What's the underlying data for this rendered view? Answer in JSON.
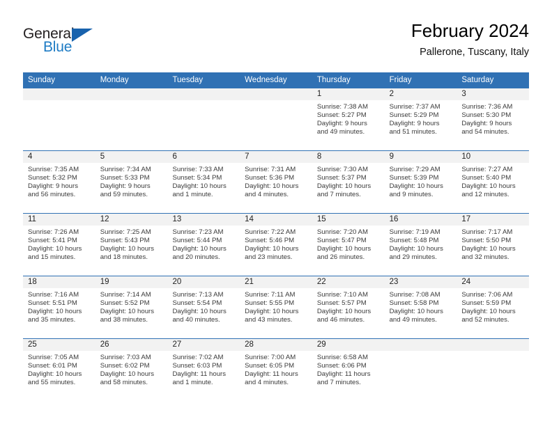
{
  "brand": {
    "name_part1": "General",
    "name_part2": "Blue"
  },
  "header": {
    "title": "February 2024",
    "location": "Pallerone, Tuscany, Italy"
  },
  "weekdays": [
    "Sunday",
    "Monday",
    "Tuesday",
    "Wednesday",
    "Thursday",
    "Friday",
    "Saturday"
  ],
  "colors": {
    "header_blue": "#3071b4",
    "day_band_grey": "#f2f2f2",
    "logo_blue": "#1d7bc4",
    "logo_dark": "#231f20"
  },
  "weeks": [
    [
      {
        "day": "",
        "sunrise": "",
        "sunset": "",
        "daylight_line1": "",
        "daylight_line2": ""
      },
      {
        "day": "",
        "sunrise": "",
        "sunset": "",
        "daylight_line1": "",
        "daylight_line2": ""
      },
      {
        "day": "",
        "sunrise": "",
        "sunset": "",
        "daylight_line1": "",
        "daylight_line2": ""
      },
      {
        "day": "",
        "sunrise": "",
        "sunset": "",
        "daylight_line1": "",
        "daylight_line2": ""
      },
      {
        "day": "1",
        "sunrise": "Sunrise: 7:38 AM",
        "sunset": "Sunset: 5:27 PM",
        "daylight_line1": "Daylight: 9 hours",
        "daylight_line2": "and 49 minutes."
      },
      {
        "day": "2",
        "sunrise": "Sunrise: 7:37 AM",
        "sunset": "Sunset: 5:29 PM",
        "daylight_line1": "Daylight: 9 hours",
        "daylight_line2": "and 51 minutes."
      },
      {
        "day": "3",
        "sunrise": "Sunrise: 7:36 AM",
        "sunset": "Sunset: 5:30 PM",
        "daylight_line1": "Daylight: 9 hours",
        "daylight_line2": "and 54 minutes."
      }
    ],
    [
      {
        "day": "4",
        "sunrise": "Sunrise: 7:35 AM",
        "sunset": "Sunset: 5:32 PM",
        "daylight_line1": "Daylight: 9 hours",
        "daylight_line2": "and 56 minutes."
      },
      {
        "day": "5",
        "sunrise": "Sunrise: 7:34 AM",
        "sunset": "Sunset: 5:33 PM",
        "daylight_line1": "Daylight: 9 hours",
        "daylight_line2": "and 59 minutes."
      },
      {
        "day": "6",
        "sunrise": "Sunrise: 7:33 AM",
        "sunset": "Sunset: 5:34 PM",
        "daylight_line1": "Daylight: 10 hours",
        "daylight_line2": "and 1 minute."
      },
      {
        "day": "7",
        "sunrise": "Sunrise: 7:31 AM",
        "sunset": "Sunset: 5:36 PM",
        "daylight_line1": "Daylight: 10 hours",
        "daylight_line2": "and 4 minutes."
      },
      {
        "day": "8",
        "sunrise": "Sunrise: 7:30 AM",
        "sunset": "Sunset: 5:37 PM",
        "daylight_line1": "Daylight: 10 hours",
        "daylight_line2": "and 7 minutes."
      },
      {
        "day": "9",
        "sunrise": "Sunrise: 7:29 AM",
        "sunset": "Sunset: 5:39 PM",
        "daylight_line1": "Daylight: 10 hours",
        "daylight_line2": "and 9 minutes."
      },
      {
        "day": "10",
        "sunrise": "Sunrise: 7:27 AM",
        "sunset": "Sunset: 5:40 PM",
        "daylight_line1": "Daylight: 10 hours",
        "daylight_line2": "and 12 minutes."
      }
    ],
    [
      {
        "day": "11",
        "sunrise": "Sunrise: 7:26 AM",
        "sunset": "Sunset: 5:41 PM",
        "daylight_line1": "Daylight: 10 hours",
        "daylight_line2": "and 15 minutes."
      },
      {
        "day": "12",
        "sunrise": "Sunrise: 7:25 AM",
        "sunset": "Sunset: 5:43 PM",
        "daylight_line1": "Daylight: 10 hours",
        "daylight_line2": "and 18 minutes."
      },
      {
        "day": "13",
        "sunrise": "Sunrise: 7:23 AM",
        "sunset": "Sunset: 5:44 PM",
        "daylight_line1": "Daylight: 10 hours",
        "daylight_line2": "and 20 minutes."
      },
      {
        "day": "14",
        "sunrise": "Sunrise: 7:22 AM",
        "sunset": "Sunset: 5:46 PM",
        "daylight_line1": "Daylight: 10 hours",
        "daylight_line2": "and 23 minutes."
      },
      {
        "day": "15",
        "sunrise": "Sunrise: 7:20 AM",
        "sunset": "Sunset: 5:47 PM",
        "daylight_line1": "Daylight: 10 hours",
        "daylight_line2": "and 26 minutes."
      },
      {
        "day": "16",
        "sunrise": "Sunrise: 7:19 AM",
        "sunset": "Sunset: 5:48 PM",
        "daylight_line1": "Daylight: 10 hours",
        "daylight_line2": "and 29 minutes."
      },
      {
        "day": "17",
        "sunrise": "Sunrise: 7:17 AM",
        "sunset": "Sunset: 5:50 PM",
        "daylight_line1": "Daylight: 10 hours",
        "daylight_line2": "and 32 minutes."
      }
    ],
    [
      {
        "day": "18",
        "sunrise": "Sunrise: 7:16 AM",
        "sunset": "Sunset: 5:51 PM",
        "daylight_line1": "Daylight: 10 hours",
        "daylight_line2": "and 35 minutes."
      },
      {
        "day": "19",
        "sunrise": "Sunrise: 7:14 AM",
        "sunset": "Sunset: 5:52 PM",
        "daylight_line1": "Daylight: 10 hours",
        "daylight_line2": "and 38 minutes."
      },
      {
        "day": "20",
        "sunrise": "Sunrise: 7:13 AM",
        "sunset": "Sunset: 5:54 PM",
        "daylight_line1": "Daylight: 10 hours",
        "daylight_line2": "and 40 minutes."
      },
      {
        "day": "21",
        "sunrise": "Sunrise: 7:11 AM",
        "sunset": "Sunset: 5:55 PM",
        "daylight_line1": "Daylight: 10 hours",
        "daylight_line2": "and 43 minutes."
      },
      {
        "day": "22",
        "sunrise": "Sunrise: 7:10 AM",
        "sunset": "Sunset: 5:57 PM",
        "daylight_line1": "Daylight: 10 hours",
        "daylight_line2": "and 46 minutes."
      },
      {
        "day": "23",
        "sunrise": "Sunrise: 7:08 AM",
        "sunset": "Sunset: 5:58 PM",
        "daylight_line1": "Daylight: 10 hours",
        "daylight_line2": "and 49 minutes."
      },
      {
        "day": "24",
        "sunrise": "Sunrise: 7:06 AM",
        "sunset": "Sunset: 5:59 PM",
        "daylight_line1": "Daylight: 10 hours",
        "daylight_line2": "and 52 minutes."
      }
    ],
    [
      {
        "day": "25",
        "sunrise": "Sunrise: 7:05 AM",
        "sunset": "Sunset: 6:01 PM",
        "daylight_line1": "Daylight: 10 hours",
        "daylight_line2": "and 55 minutes."
      },
      {
        "day": "26",
        "sunrise": "Sunrise: 7:03 AM",
        "sunset": "Sunset: 6:02 PM",
        "daylight_line1": "Daylight: 10 hours",
        "daylight_line2": "and 58 minutes."
      },
      {
        "day": "27",
        "sunrise": "Sunrise: 7:02 AM",
        "sunset": "Sunset: 6:03 PM",
        "daylight_line1": "Daylight: 11 hours",
        "daylight_line2": "and 1 minute."
      },
      {
        "day": "28",
        "sunrise": "Sunrise: 7:00 AM",
        "sunset": "Sunset: 6:05 PM",
        "daylight_line1": "Daylight: 11 hours",
        "daylight_line2": "and 4 minutes."
      },
      {
        "day": "29",
        "sunrise": "Sunrise: 6:58 AM",
        "sunset": "Sunset: 6:06 PM",
        "daylight_line1": "Daylight: 11 hours",
        "daylight_line2": "and 7 minutes."
      },
      {
        "day": "",
        "sunrise": "",
        "sunset": "",
        "daylight_line1": "",
        "daylight_line2": ""
      },
      {
        "day": "",
        "sunrise": "",
        "sunset": "",
        "daylight_line1": "",
        "daylight_line2": ""
      }
    ]
  ]
}
